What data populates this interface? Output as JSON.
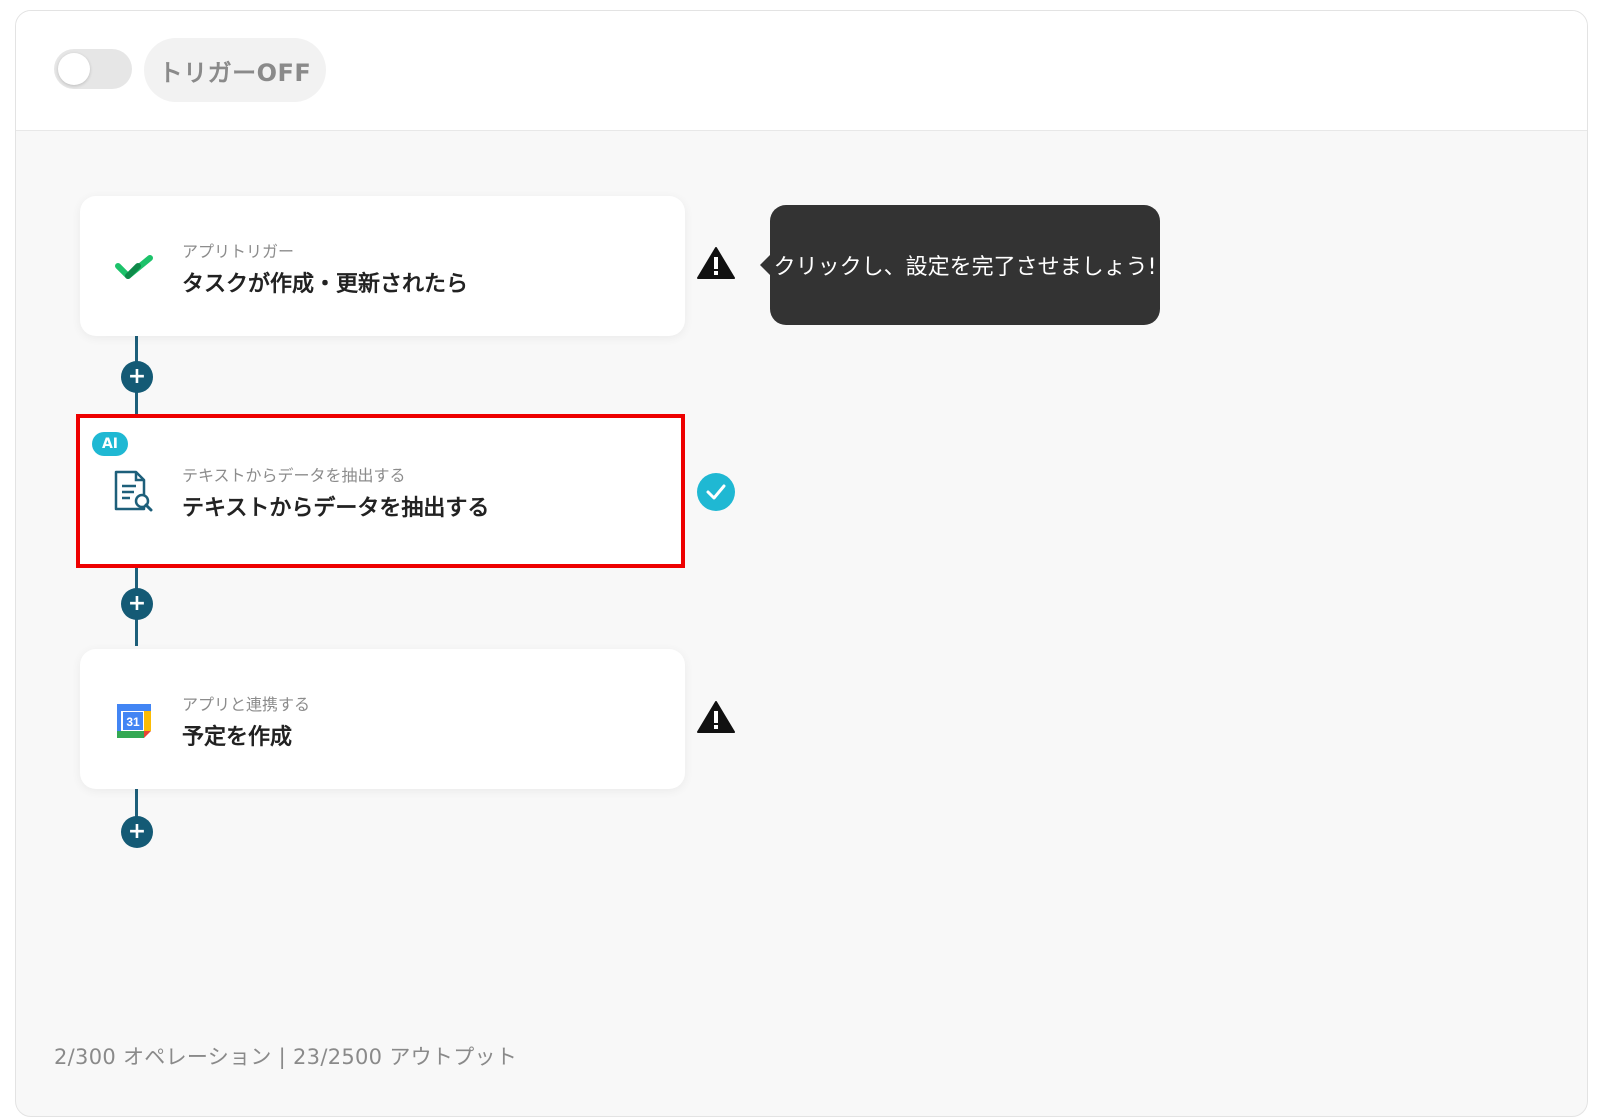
{
  "header": {
    "toggle_state": "off",
    "trigger_label": "トリガーOFF"
  },
  "steps": [
    {
      "icon": "check-logo-icon",
      "subtitle": "アプリトリガー",
      "title": "タスクが作成・更新されたら",
      "status": "warning"
    },
    {
      "icon": "document-search-icon",
      "badge": "AI",
      "subtitle": "テキストからデータを抽出する",
      "title": "テキストからデータを抽出する",
      "status": "complete",
      "highlighted": true
    },
    {
      "icon": "google-calendar-icon",
      "calendar_day": "31",
      "subtitle": "アプリと連携する",
      "title": "予定を作成",
      "status": "warning"
    }
  ],
  "tooltip": {
    "text": "クリックし、設定を完了させましょう!"
  },
  "footer": {
    "usage": "2/300 オペレーション | 23/2500 アウトプット"
  },
  "colors": {
    "accent": "#145a75",
    "highlight_border": "#ee0000",
    "ai_badge": "#1fb8d3",
    "complete": "#1fb8d3",
    "warning": "#111111"
  }
}
